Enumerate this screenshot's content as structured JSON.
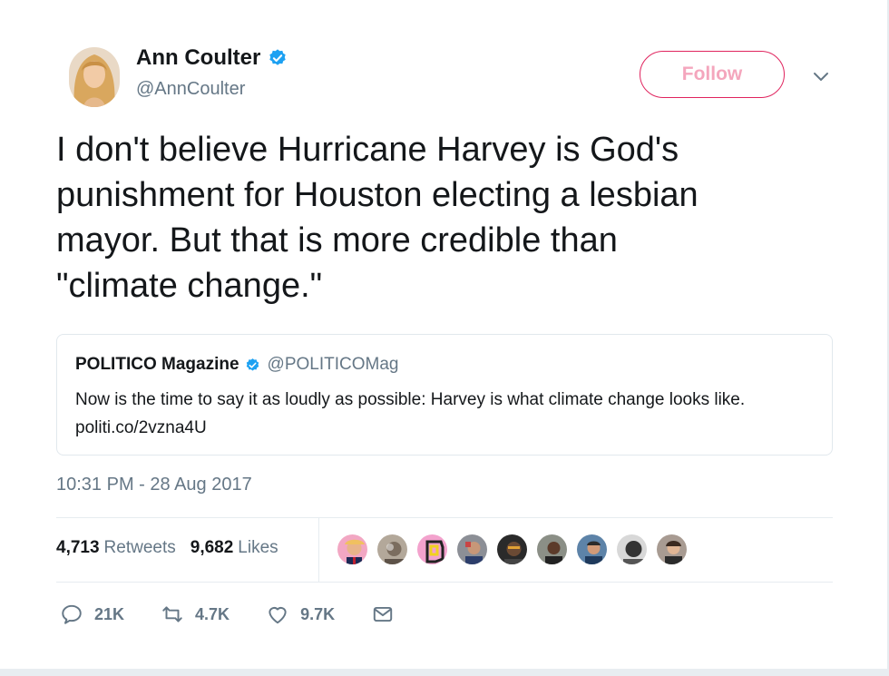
{
  "author": {
    "name": "Ann Coulter",
    "handle": "@AnnCoulter",
    "avatar_icon": "user-avatar-icon"
  },
  "follow_label": "Follow",
  "tweet": {
    "text": "I don't believe Hurricane Harvey is God's\npunishment for Houston electing a lesbian\nmayor. But that is more credible than\n\"climate change.\""
  },
  "quoted": {
    "name": "POLITICO Magazine",
    "handle": "@POLITICOMag",
    "text": "Now is the time to say it as loudly as possible: Harvey is what climate change looks like. politi.co/2vzna4U"
  },
  "timestamp": "10:31 PM - 28 Aug 2017",
  "stats": {
    "retweets_count": "4,713",
    "retweets_label": "Retweets",
    "likes_count": "9,682",
    "likes_label": "Likes"
  },
  "liker_avatars": [
    "avatar-1",
    "avatar-2",
    "avatar-3",
    "avatar-4",
    "avatar-5",
    "avatar-6",
    "avatar-7",
    "avatar-8",
    "avatar-9"
  ],
  "actions": {
    "reply_count": "21K",
    "retweet_count": "4.7K",
    "like_count": "9.7K"
  },
  "colors": {
    "text_primary": "#14171a",
    "text_secondary": "#657786",
    "verified_blue": "#1da1f2",
    "follow_pink": "#e0245e",
    "border": "#e1e8ed"
  }
}
